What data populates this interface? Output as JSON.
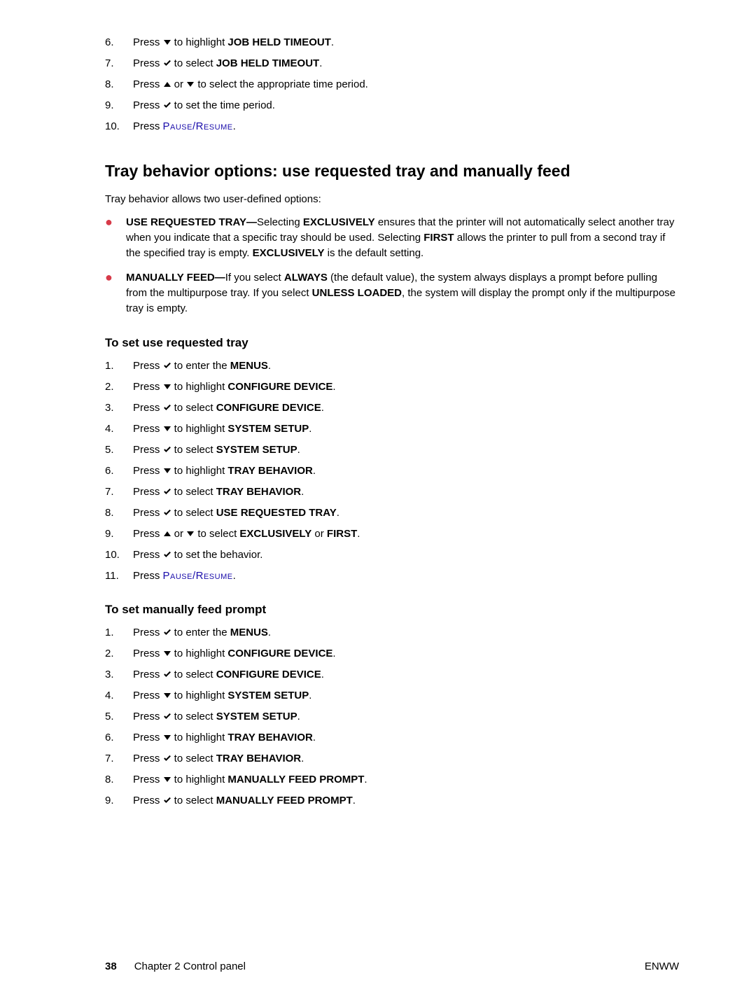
{
  "topList": [
    {
      "num": "6.",
      "pre": "Press ",
      "icon": "down",
      "mid": " to highlight ",
      "boldA": "JOB HELD TIMEOUT",
      "post": "."
    },
    {
      "num": "7.",
      "pre": "Press ",
      "icon": "check",
      "mid": " to select ",
      "boldA": "JOB HELD TIMEOUT",
      "post": "."
    },
    {
      "num": "8.",
      "pre": "Press ",
      "icon": "up",
      "mid": " or ",
      "icon2": "down",
      "mid2": " to select the appropriate time period.",
      "boldA": "",
      "post": ""
    },
    {
      "num": "9.",
      "pre": "Press ",
      "icon": "check",
      "mid": " to set the time period.",
      "boldA": "",
      "post": ""
    },
    {
      "num": "10.",
      "pre": "Press ",
      "link": "Pause/Resume",
      "post": "."
    }
  ],
  "heading": "Tray behavior options: use requested tray and manually feed",
  "intro": "Tray behavior allows two user-defined options:",
  "bullets": [
    {
      "b1": "USE REQUESTED TRAY—",
      "t1": "Selecting ",
      "b2": "EXCLUSIVELY",
      "t2": " ensures that the printer will not automatically select another tray when you indicate that a specific tray should be used. Selecting ",
      "b3": "FIRST",
      "t3": " allows the printer to pull from a second tray if the specified tray is empty. ",
      "b4": "EXCLUSIVELY",
      "t4": " is the default setting."
    },
    {
      "b1": "MANUALLY FEED—",
      "t1": "If you select ",
      "b2": "ALWAYS",
      "t2": " (the default value), the system always displays a prompt before pulling from the multipurpose tray. If you select ",
      "b3": "UNLESS LOADED",
      "t3": ", the system will display the prompt only if the multipurpose tray is empty.",
      "b4": "",
      "t4": ""
    }
  ],
  "sub1": "To set use requested tray",
  "list1": [
    {
      "num": "1.",
      "pre": "Press ",
      "icon": "check",
      "mid": " to enter the ",
      "bold": "MENUS",
      "post": "."
    },
    {
      "num": "2.",
      "pre": "Press ",
      "icon": "down",
      "mid": " to highlight ",
      "bold": "CONFIGURE DEVICE",
      "post": "."
    },
    {
      "num": "3.",
      "pre": "Press ",
      "icon": "check",
      "mid": " to select ",
      "bold": "CONFIGURE DEVICE",
      "post": "."
    },
    {
      "num": "4.",
      "pre": "Press ",
      "icon": "down",
      "mid": " to highlight ",
      "bold": "SYSTEM SETUP",
      "post": "."
    },
    {
      "num": "5.",
      "pre": "Press ",
      "icon": "check",
      "mid": " to select ",
      "bold": "SYSTEM SETUP",
      "post": "."
    },
    {
      "num": "6.",
      "pre": "Press ",
      "icon": "down",
      "mid": " to highlight ",
      "bold": "TRAY BEHAVIOR",
      "post": "."
    },
    {
      "num": "7.",
      "pre": "Press ",
      "icon": "check",
      "mid": " to select ",
      "bold": "TRAY BEHAVIOR",
      "post": "."
    },
    {
      "num": "8.",
      "pre": "Press ",
      "icon": "check",
      "mid": " to select ",
      "bold": "USE REQUESTED TRAY",
      "post": "."
    },
    {
      "num": "9.",
      "pre": "Press ",
      "icon": "up",
      "midOr": " or ",
      "icon2": "down",
      "mid": " to select ",
      "bold": "EXCLUSIVELY",
      "midOr2": " or ",
      "bold2": "FIRST",
      "post": "."
    },
    {
      "num": "10.",
      "pre": "Press ",
      "icon": "check",
      "mid": " to set the behavior.",
      "bold": "",
      "post": ""
    },
    {
      "num": "11.",
      "pre": "Press ",
      "link": "Pause/Resume",
      "post": "."
    }
  ],
  "sub2": "To set manually feed prompt",
  "list2": [
    {
      "num": "1.",
      "pre": "Press ",
      "icon": "check",
      "mid": " to enter the ",
      "bold": "MENUS",
      "post": "."
    },
    {
      "num": "2.",
      "pre": "Press ",
      "icon": "down",
      "mid": " to highlight ",
      "bold": "CONFIGURE DEVICE",
      "post": "."
    },
    {
      "num": "3.",
      "pre": "Press ",
      "icon": "check",
      "mid": " to select ",
      "bold": "CONFIGURE DEVICE",
      "post": "."
    },
    {
      "num": "4.",
      "pre": "Press ",
      "icon": "down",
      "mid": " to highlight ",
      "bold": "SYSTEM SETUP",
      "post": "."
    },
    {
      "num": "5.",
      "pre": "Press ",
      "icon": "check",
      "mid": " to select ",
      "bold": "SYSTEM SETUP",
      "post": "."
    },
    {
      "num": "6.",
      "pre": "Press ",
      "icon": "down",
      "mid": " to highlight ",
      "bold": "TRAY BEHAVIOR",
      "post": "."
    },
    {
      "num": "7.",
      "pre": "Press ",
      "icon": "check",
      "mid": " to select ",
      "bold": "TRAY BEHAVIOR",
      "post": "."
    },
    {
      "num": "8.",
      "pre": "Press ",
      "icon": "down",
      "mid": " to highlight ",
      "bold": "MANUALLY FEED PROMPT",
      "post": "."
    },
    {
      "num": "9.",
      "pre": "Press ",
      "icon": "check",
      "mid": " to select ",
      "bold": "MANUALLY FEED PROMPT",
      "post": "."
    }
  ],
  "footer": {
    "pageNum": "38",
    "chapter": "Chapter 2  Control panel",
    "right": "ENWW"
  }
}
